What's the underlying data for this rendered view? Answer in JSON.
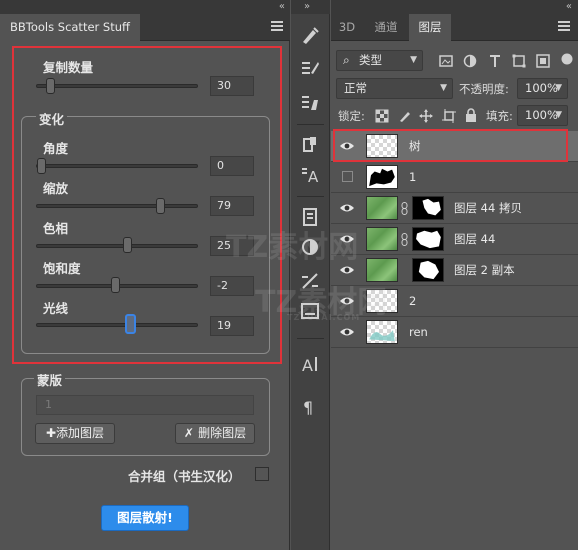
{
  "left_panel": {
    "title": "BBTools Scatter Stuff",
    "copies": {
      "label": "复制数量",
      "value": "30",
      "level": 0.05
    },
    "variation": {
      "legend": "变化",
      "angle": {
        "label": "角度",
        "value": "0",
        "level": 0.05
      },
      "scale": {
        "label": "缩放",
        "value": "79",
        "level": 0.79
      },
      "hue": {
        "label": "色相",
        "value": "25",
        "level": 0.56
      },
      "saturation": {
        "label": "饱和度",
        "value": "-2",
        "level": 0.49
      },
      "light": {
        "label": "光线",
        "value": "19",
        "level": 0.59
      }
    },
    "mask": {
      "legend": "蒙版",
      "value": "1",
      "add_layer": "添加图层",
      "delete_layer": "删除图层"
    },
    "merge_label": "合并组（书生汉化）",
    "scatter_button": "图层散射!"
  },
  "layers_panel": {
    "tabs": [
      "3D",
      "通道",
      "图层"
    ],
    "filter_kind": "类型",
    "blend_mode": "正常",
    "opacity_label": "不透明度:",
    "opacity_value": "100%",
    "lock_label": "锁定:",
    "fill_label": "填充:",
    "fill_value": "100%",
    "layers": [
      {
        "name": "树",
        "visible": true,
        "thumb": "transparent",
        "selected": true
      },
      {
        "name": "1",
        "visible": false,
        "thumb": "black-mask"
      },
      {
        "name": "图层 44 拷贝",
        "visible": true,
        "thumb": "green",
        "mask": "white-shape"
      },
      {
        "name": "图层 44",
        "visible": true,
        "thumb": "green",
        "mask": "white-shape"
      },
      {
        "name": "图层 2 副本",
        "visible": true,
        "thumb": "green",
        "mask": "white-shape"
      },
      {
        "name": "2",
        "visible": true,
        "thumb": "transparent"
      },
      {
        "name": "ren",
        "visible": true,
        "thumb": "cyan-sketch"
      }
    ]
  },
  "colors": {
    "highlight_red": "#e0333a",
    "primary_blue": "#2d8ceb",
    "slider_focus": "#3b84e6"
  },
  "watermark": {
    "text": "TZ素材网",
    "sub": "TZSUCAI.COM"
  }
}
